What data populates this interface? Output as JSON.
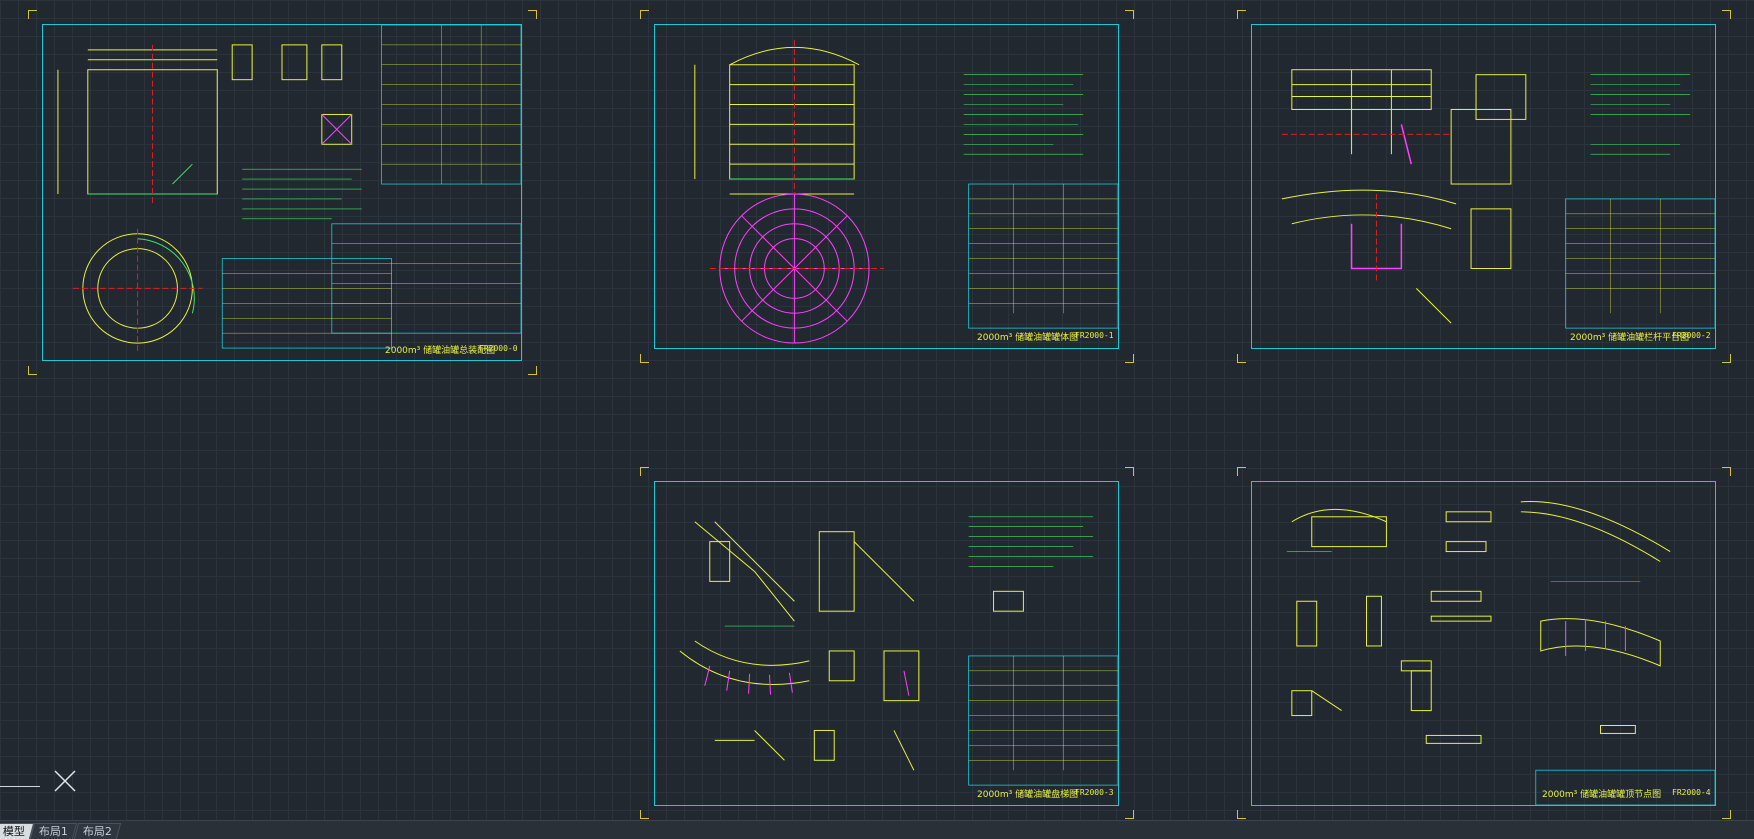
{
  "workspace": {
    "grid_color": "#2b333d",
    "background": "#212830",
    "frame_color": "#1ec8d6",
    "drawing_colors": [
      "#e8f040",
      "#3ee860",
      "#ff40ff",
      "#e02020",
      "#ffffff"
    ]
  },
  "sheets": [
    {
      "title": "2000m³ 储罐油罐总装配图",
      "code": "FR2000-0"
    },
    {
      "title": "2000m³ 储罐油罐罐体图",
      "code": "FR2000-1"
    },
    {
      "title": "2000m³ 储罐油罐栏杆平台图",
      "code": "FR2000-2"
    },
    {
      "title": "2000m³ 储罐油罐盘梯图",
      "code": "FR2000-3"
    },
    {
      "title": "2000m³ 储罐油罐罐顶节点图",
      "code": "FR2000-4"
    }
  ],
  "layout_tabs": [
    {
      "label": "模型",
      "active": true
    },
    {
      "label": "布局1",
      "active": false
    },
    {
      "label": "布局2",
      "active": false
    }
  ],
  "crosshair_icon": "close-icon"
}
